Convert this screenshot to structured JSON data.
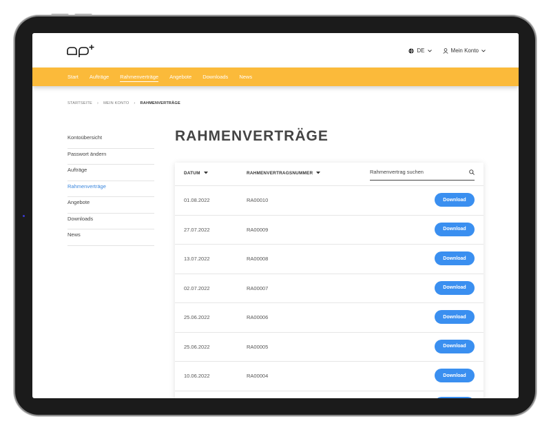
{
  "header": {
    "logo_text": "ap+",
    "language": "DE",
    "account": "Mein Konto"
  },
  "nav": {
    "items": [
      "Start",
      "Aufträge",
      "Rahmenverträge",
      "Angebote",
      "Downloads",
      "News"
    ],
    "active": "Rahmenverträge"
  },
  "breadcrumb": [
    "STARTSEITE",
    "MEIN KONTO",
    "RAHMENVERTRÄGE"
  ],
  "sidebar": {
    "items": [
      "Kontoübersicht",
      "Passwort ändern",
      "Aufträge",
      "Rahmenverträge",
      "Angebote",
      "Downloads",
      "News"
    ],
    "active": "Rahmenverträge"
  },
  "page_title": "RAHMENVERTRÄGE",
  "table": {
    "columns": [
      "DATUM",
      "RAHMENVERTRAGSNUMMER"
    ],
    "search_placeholder": "Rahmenvertrag suchen",
    "rows": [
      {
        "date": "01.08.2022",
        "number": "RA00010",
        "action": "Download"
      },
      {
        "date": "27.07.2022",
        "number": "RA00009",
        "action": "Download"
      },
      {
        "date": "13.07.2022",
        "number": "RA00008",
        "action": "Download"
      },
      {
        "date": "02.07.2022",
        "number": "RA00007",
        "action": "Download"
      },
      {
        "date": "25.06.2022",
        "number": "RA00006",
        "action": "Download"
      },
      {
        "date": "25.06.2022",
        "number": "RA00005",
        "action": "Download"
      },
      {
        "date": "10.06.2022",
        "number": "RA00004",
        "action": "Download"
      }
    ]
  },
  "colors": {
    "nav_bg": "#fbba3a",
    "accent_blue": "#3a8ff0",
    "active_link": "#3a86dd"
  }
}
